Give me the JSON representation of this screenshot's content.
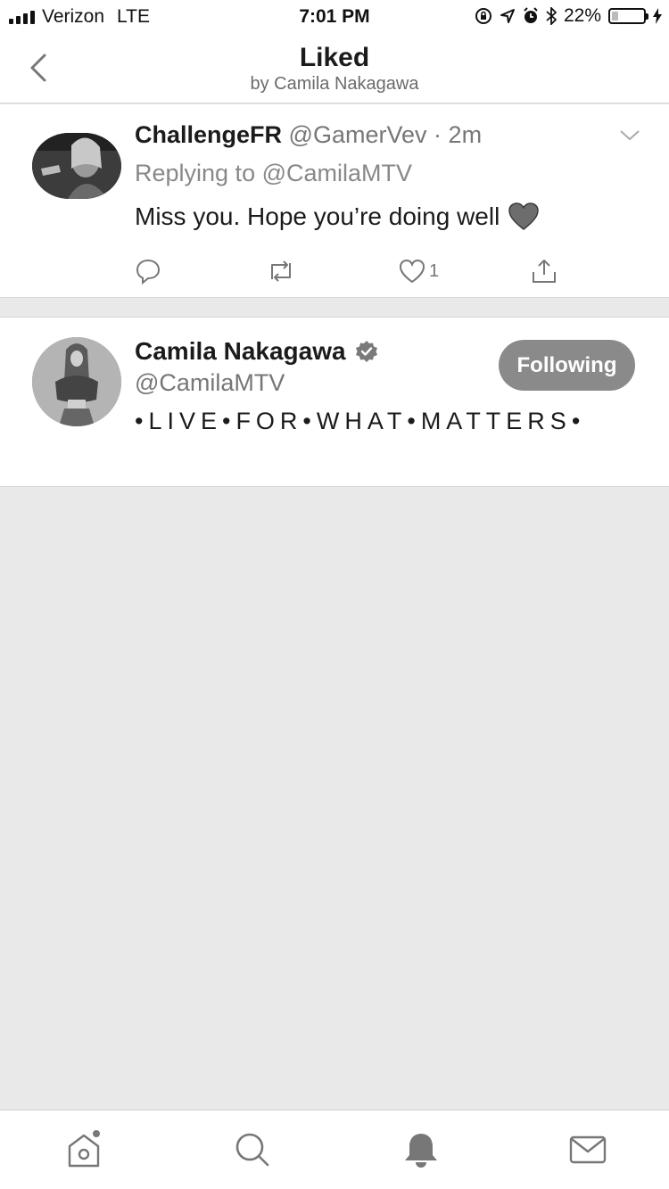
{
  "status_bar": {
    "carrier": "Verizon",
    "network": "LTE",
    "time": "7:01 PM",
    "battery": "22%",
    "battery_level": 0.22
  },
  "nav": {
    "title": "Liked",
    "subtitle": "by Camila Nakagawa"
  },
  "tweet": {
    "name": "ChallengeFR",
    "handle": "@GamerVev",
    "separator": "·",
    "time": "2m",
    "replying_to": "Replying to @CamilaMTV",
    "text": "Miss you. Hope you’re doing well",
    "like_count": "1"
  },
  "user": {
    "name": "Camila Nakagawa",
    "handle": "@CamilaMTV",
    "bio": "•LIVE•FOR•WHAT•MATTERS•",
    "follow_label": "Following"
  },
  "tabs": [
    "home",
    "search",
    "notifications",
    "messages"
  ],
  "colors": {
    "background": "#e9e9e9",
    "button": "#8a8a8a",
    "muted_text": "#777777"
  }
}
